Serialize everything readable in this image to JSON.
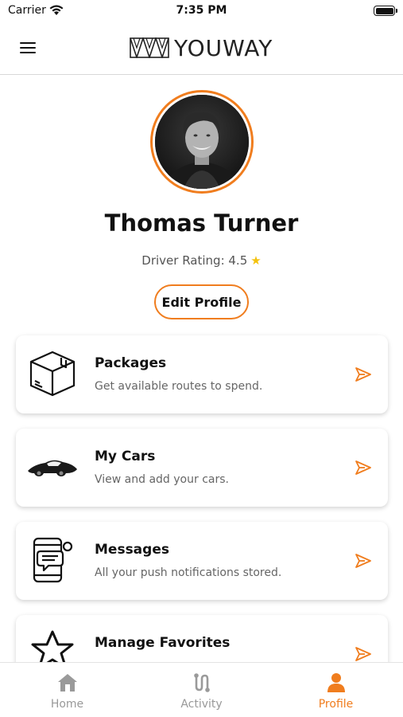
{
  "status_bar": {
    "carrier": "Carrier",
    "time": "7:35 PM"
  },
  "header": {
    "logo_text": "YOUWAY",
    "menu_icon": "hamburger-menu-icon"
  },
  "profile": {
    "name": "Thomas Turner",
    "rating_label": "Driver Rating: 4.5",
    "rating_star": "★",
    "edit_button": "Edit Profile"
  },
  "menu": [
    {
      "title": "Packages",
      "subtitle": "Get available routes to spend.",
      "icon": "package-box-icon"
    },
    {
      "title": "My Cars",
      "subtitle": "View and add your cars.",
      "icon": "car-icon"
    },
    {
      "title": "Messages",
      "subtitle": "All your push notifications stored.",
      "icon": "phone-message-icon"
    },
    {
      "title": "Manage Favorites",
      "subtitle": "",
      "icon": "star-badge-icon"
    }
  ],
  "tabs": [
    {
      "label": "Home",
      "icon": "home-icon",
      "active": false
    },
    {
      "label": "Activity",
      "icon": "route-icon",
      "active": false
    },
    {
      "label": "Profile",
      "icon": "user-icon",
      "active": true
    }
  ],
  "colors": {
    "accent": "#f07d1e",
    "star": "#f4c20d",
    "text": "#111111",
    "muted": "#666666"
  }
}
